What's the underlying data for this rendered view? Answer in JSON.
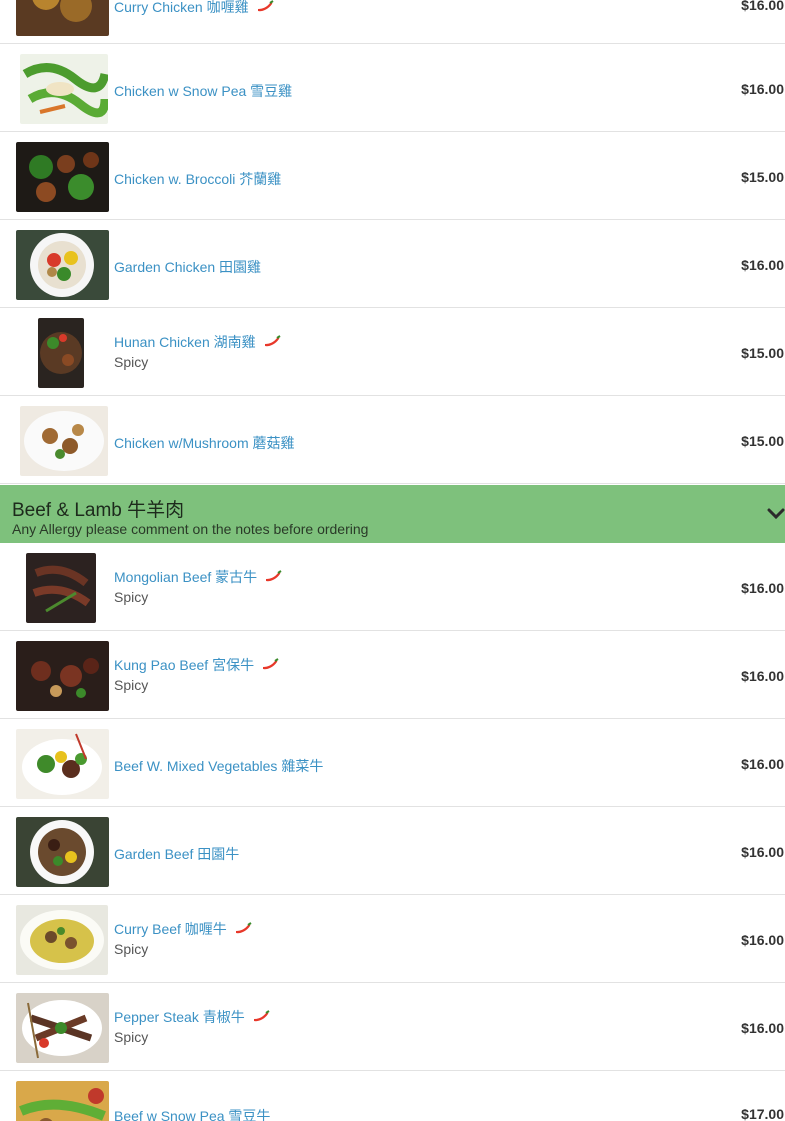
{
  "section": {
    "title": "Beef & Lamb 牛羊肉",
    "note": "Any Allergy please comment on the notes before ordering",
    "accent": "#7ec17c"
  },
  "items": [
    {
      "name": "Curry Chicken 咖喱雞",
      "price": "$16.00",
      "spicy": true
    },
    {
      "name": "Chicken w Snow Pea 雪豆雞",
      "price": "$16.00"
    },
    {
      "name": "Chicken w. Broccoli 芥蘭雞",
      "price": "$15.00"
    },
    {
      "name": "Garden Chicken 田園雞",
      "price": "$16.00"
    },
    {
      "name": "Hunan Chicken 湖南雞",
      "price": "$15.00",
      "spicy": true,
      "sub": "Spicy"
    },
    {
      "name": "Chicken w/Mushroom 蘑菇雞",
      "price": "$15.00"
    },
    {
      "name": "Mongolian Beef 蒙古牛",
      "price": "$16.00",
      "spicy": true,
      "sub": "Spicy"
    },
    {
      "name": "Kung Pao Beef 宮保牛",
      "price": "$16.00",
      "spicy": true,
      "sub": "Spicy"
    },
    {
      "name": "Beef W. Mixed Vegetables 雜菜牛",
      "price": "$16.00"
    },
    {
      "name": "Garden Beef 田園牛",
      "price": "$16.00"
    },
    {
      "name": "Curry Beef 咖喱牛",
      "price": "$16.00",
      "spicy": true,
      "sub": "Spicy"
    },
    {
      "name": "Pepper Steak 青椒牛",
      "price": "$16.00",
      "spicy": true,
      "sub": "Spicy"
    },
    {
      "name": "Beef w Snow Pea 雪豆牛",
      "price": "$17.00"
    }
  ],
  "icons": {
    "spicy": "chili-pepper-icon",
    "collapse": "chevron-down-icon"
  },
  "colors": {
    "link": "#3b91c4",
    "chili": "#e8382a"
  }
}
